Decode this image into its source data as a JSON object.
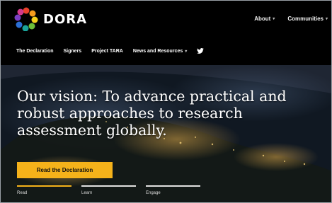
{
  "brand": {
    "name": "DORA"
  },
  "top_nav": [
    {
      "label": "About",
      "icon": "chevron-down-icon"
    },
    {
      "label": "Communities",
      "icon": "chevron-down-icon"
    }
  ],
  "main_nav": [
    {
      "label": "The Declaration"
    },
    {
      "label": "Signers"
    },
    {
      "label": "Project TARA"
    },
    {
      "label": "News and Resources",
      "icon": "chevron-down-icon"
    }
  ],
  "social": {
    "icon": "twitter-icon"
  },
  "hero": {
    "headline": "Our vision: To advance practical and robust approaches to research assessment globally.",
    "cta_label": "Read the Declaration",
    "steps": [
      {
        "label": "Read",
        "active": true
      },
      {
        "label": "Learn",
        "active": false
      },
      {
        "label": "Engage",
        "active": false
      }
    ]
  },
  "colors": {
    "accent": "#f5b21a",
    "header_bg": "#000000"
  }
}
